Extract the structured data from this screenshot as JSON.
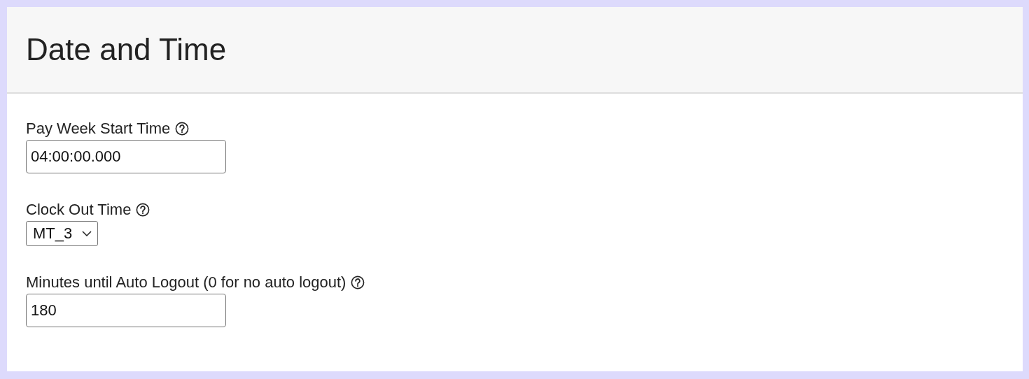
{
  "panel": {
    "title": "Date and Time"
  },
  "fields": [
    {
      "kind": "text",
      "label": "Pay Week Start Time",
      "help": true,
      "value": "04:00:00.000"
    },
    {
      "kind": "select",
      "label": "Clock Out Time",
      "help": true,
      "value": "MT_3"
    },
    {
      "kind": "text",
      "label": "Minutes until Auto Logout (0 for no auto logout)",
      "help": true,
      "value": "180"
    }
  ]
}
